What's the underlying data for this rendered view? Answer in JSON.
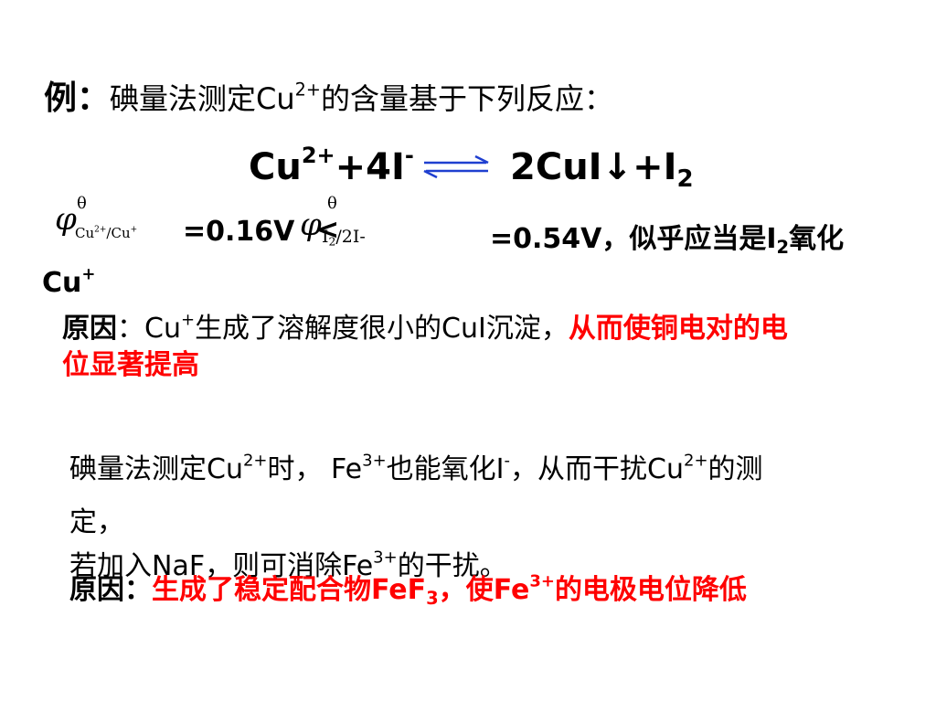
{
  "intro": {
    "label": "例：",
    "text_before": "碘量法测定Cu",
    "sup": "2+",
    "text_after": "的含量基于下列反应："
  },
  "reaction": {
    "left": "Cu",
    "left_sup": "2+",
    "left_mid": "+4I",
    "left_sup2": "-",
    "right": "2CuI↓+I",
    "right_sub": "2"
  },
  "potentials": {
    "phi": "φ",
    "theta": "θ",
    "sub1": "Cu",
    "sub1_sup": "2+",
    "sub1_mid": "/Cu",
    "sub1_sup2": "+",
    "value1": "=0.16V",
    "lt": "<",
    "sub2": "I",
    "sub2_sub": "2",
    "sub2_tail": "/2I-",
    "value2": "=0.54V，似乎应当是I",
    "value2_sub": "2",
    "value2_tail": "氧化",
    "cu_plus": "Cu",
    "cu_plus_sup": "+"
  },
  "reason1": {
    "label": "原因",
    "colon": "：Cu",
    "sup": "+",
    "text": "生成了溶解度很小的CuI沉淀，",
    "red_line1": "从而使铜电对的电",
    "red_line2": "位显著提高"
  },
  "para2": {
    "t1": "碘量法测定Cu",
    "s1": "2+",
    "t2": "时， Fe",
    "s2": "3+",
    "t3": "也能氧化I",
    "s3": "-",
    "t4": "，从而干扰Cu",
    "s4": "2+",
    "t5": "的测",
    "line2": "定，",
    "l3_t1": "若加入NaF，则可消除Fe",
    "l3_s1": "3+",
    "l3_t2": "的干扰。"
  },
  "reason2": {
    "label": "原因：",
    "t1": "生成了稳定配合物FeF",
    "sub": "3",
    "t2": "，使Fe",
    "sup": "3+",
    "t3": "的电极电位降低"
  },
  "colors": {
    "red": "#ff0000",
    "arrow": "#1f3fd0"
  }
}
